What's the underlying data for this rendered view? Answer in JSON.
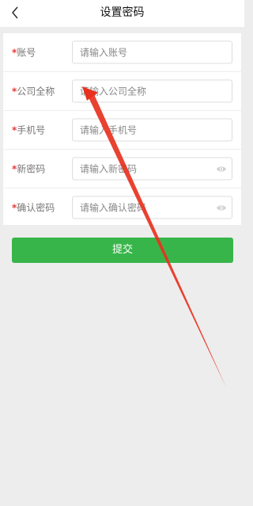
{
  "header": {
    "title": "设置密码",
    "back_icon": "chevron-left-icon"
  },
  "form": {
    "required_mark": "*",
    "fields": [
      {
        "label": "账号",
        "placeholder": "请输入账号",
        "value": "",
        "has_eye": false
      },
      {
        "label": "公司全称",
        "placeholder": "请输入公司全称",
        "value": "",
        "has_eye": false
      },
      {
        "label": "手机号",
        "placeholder": "请输入手机号",
        "value": "",
        "has_eye": false
      },
      {
        "label": "新密码",
        "placeholder": "请输入新密码",
        "value": "",
        "has_eye": true
      },
      {
        "label": "确认密码",
        "placeholder": "请输入确认密码",
        "value": "",
        "has_eye": true
      }
    ],
    "eye_icon": "eye-icon"
  },
  "submit": {
    "label": "提交"
  },
  "colors": {
    "accent": "#38b54a",
    "required": "#e23b3b",
    "annotation_arrow": "#e8321f",
    "background": "#ededed"
  }
}
